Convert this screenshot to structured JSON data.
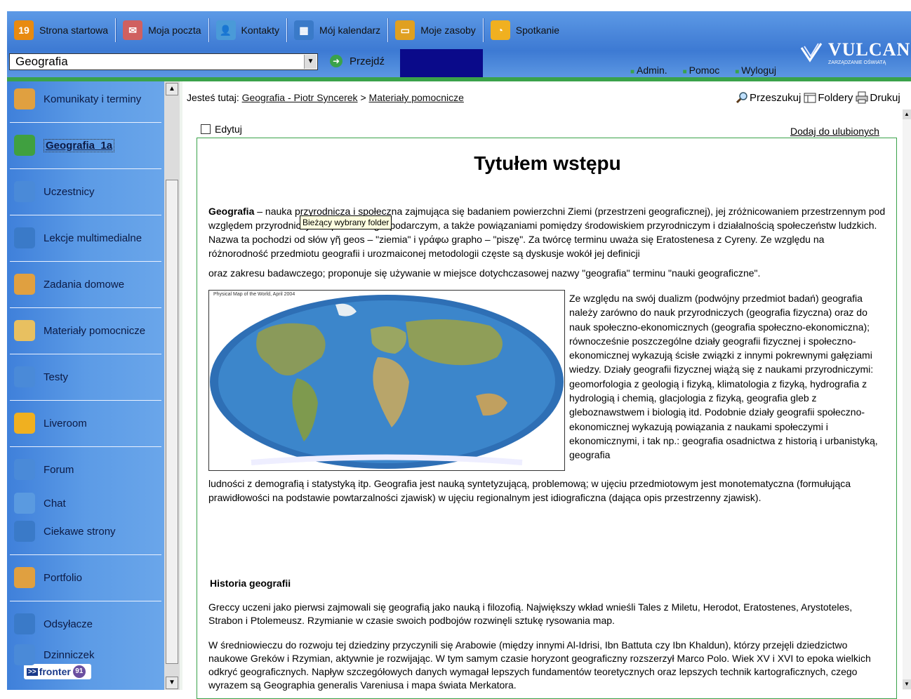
{
  "topnav": [
    {
      "label": "Strona startowa",
      "icon": "calendar-19-icon",
      "color": "#e88a10",
      "glyph": "19"
    },
    {
      "label": "Moja poczta",
      "icon": "mail-icon",
      "color": "#d06060",
      "glyph": "✉"
    },
    {
      "label": "Kontakty",
      "icon": "contacts-icon",
      "color": "#4a9ad8",
      "glyph": "👤"
    },
    {
      "label": "Mój kalendarz",
      "icon": "calendar-icon",
      "color": "#3a7ac8",
      "glyph": "▦"
    },
    {
      "label": "Moje zasoby",
      "icon": "folder-icon",
      "color": "#e0a020",
      "glyph": "▭"
    },
    {
      "label": "Spotkanie",
      "icon": "meeting-icon",
      "color": "#f0b020",
      "glyph": "◔"
    }
  ],
  "selector": {
    "value": "Geografia",
    "go_label": "Przejdź"
  },
  "toplinks": [
    "Admin.",
    "Pomoc",
    "Wyloguj"
  ],
  "logo": {
    "name": "VULCAN",
    "tagline": "ZARZĄDZANIE OŚWIATĄ"
  },
  "sidebar": [
    {
      "label": "Komunikaty i terminy",
      "icon": "announcements-icon",
      "color": "#e0a040"
    },
    {
      "label": "Geografia_1a",
      "icon": "course-icon",
      "color": "#40a040",
      "active": true
    },
    {
      "label": "Uczestnicy",
      "icon": "participants-icon",
      "color": "#4a8ad8"
    },
    {
      "label": "Lekcje multimedialne",
      "icon": "multimedia-icon",
      "color": "#3a7ac8"
    },
    {
      "label": "Zadania domowe",
      "icon": "homework-icon",
      "color": "#e0a040"
    },
    {
      "label": "Materiały pomocnicze",
      "icon": "materials-folder-icon",
      "color": "#e8c060"
    },
    {
      "label": "Testy",
      "icon": "tests-icon",
      "color": "#4a8ad8"
    },
    {
      "label": "Liveroom",
      "icon": "liveroom-icon",
      "color": "#f0b020"
    },
    {
      "label": "Forum",
      "icon": "forum-icon",
      "color": "#4a8ad8"
    },
    {
      "label": "Chat",
      "icon": "chat-icon",
      "color": "#5a9ae0"
    },
    {
      "label": "Ciekawe strony",
      "icon": "websites-icon",
      "color": "#3a7ac8"
    },
    {
      "label": "Portfolio",
      "icon": "portfolio-icon",
      "color": "#e0a040"
    },
    {
      "label": "Odsyłacze",
      "icon": "links-icon",
      "color": "#3a7ac8"
    },
    {
      "label": "Dzinniczek",
      "icon": "diary-icon",
      "color": "#4a8ad8"
    }
  ],
  "fronter": {
    "label": "fronter",
    "version": "91"
  },
  "breadcrumb": {
    "prefix": "Jesteś tutaj:",
    "items": [
      "Geografia - Piotr Syncerek",
      "Materiały pomocnicze"
    ],
    "sep": ">"
  },
  "tools": [
    "Przeszukuj",
    "Foldery",
    "Drukuj"
  ],
  "edit_label": "Edytuj",
  "fav_label": "Dodaj do ulubionych",
  "tooltip": "Bieżący wybrany folder",
  "article": {
    "title": "Tytułem wstępu",
    "intro_bold": "Geografia",
    "intro_rest": " – nauka przyrodnicza i społeczna zajmująca się badaniem powierzchni Ziemi (przestrzeni geograficznej), jej zróżnicowaniem przestrzennym pod względem przyrodniczym i społeczno-gospodarczym, a także powiązaniami pomiędzy środowiskiem przyrodniczym i działalnością społeczeństw ludzkich. Nazwa ta pochodzi od słów γῆ geos – \"ziemia\" i γράφω grapho – \"piszę\". Za twórcę terminu uważa się Eratostenesa z Cyreny. Ze względu na różnorodność przedmiotu geografii i urozmaiconej metodologii częste są dyskusje wokół jej definicji",
    "line2": "oraz zakresu badawczego; proponuje się używanie w miejsce dotychczasowej nazwy \"geografia\" terminu \"nauki geograficzne\".",
    "map_title": "Physical Map of the World, April 2004",
    "wrap_text": "Ze względu na swój dualizm (podwójny przedmiot badań) geografia należy zarówno do nauk przyrodniczych (geografia fizyczna) oraz do nauk społeczno-ekonomicznych (geografia społeczno-ekonomiczna); równocześnie poszczególne działy geografii fizycznej i społeczno-ekonomicznej wykazują ścisłe związki z innymi pokrewnymi gałęziami wiedzy. Działy geografii fizycznej wiążą się z naukami przyrodniczymi: geomorfologia z geologią i fizyką, klimatologia z fizyką, hydrografia z hydrologią i chemią, glacjologia z fizyką, geografia gleb z gleboznawstwem i biologią itd. Podobnie działy geografii społeczno-ekonomicznej wykazują powiązania z naukami społeczymi i ekonomicznymi, i tak np.: geografia osadnictwa z historią i urbanistyką, geografia",
    "after_map": "ludności z demografią i statystyką itp. Geografia jest nauką syntetyzującą, problemową; w ujęciu przedmiotowym jest monotematyczna (formułująca prawidłowości na podstawie powtarzalności zjawisk) w ujęciu regionalnym jest idiograficzna (dająca opis przestrzenny zjawisk).",
    "h2": "Historia geografii",
    "p_hist1": "Greccy uczeni jako pierwsi zajmowali się geografią jako nauką i filozofią. Największy wkład wnieśli Tales z Miletu, Herodot, Eratostenes, Arystoteles, Strabon i Ptolemeusz. Rzymianie w czasie swoich podbojów rozwinęli sztukę rysowania map.",
    "p_hist2": "W średniowieczu do rozwoju tej dziedziny przyczynili się Arabowie (między innymi Al-Idrisi, Ibn Battuta czy Ibn Khaldun), którzy przejęli dziedzictwo naukowe Greków i Rzymian, aktywnie je rozwijając. W tym samym czasie horyzont geograficzny rozszerzył Marco Polo. Wiek XV i XVI to epoka wielkich odkryć geograficznych. Napływ szczegółowych danych wymagał lepszych fundamentów teoretycznych oraz lepszych technik kartograficznych, czego wyrazem są Geographia generalis Vareniusa i mapa świata Merkatora."
  },
  "colors": {
    "accent_green": "#3aa24a",
    "nav_blue": "#4a86da",
    "dark_box": "#0a0a8a"
  }
}
